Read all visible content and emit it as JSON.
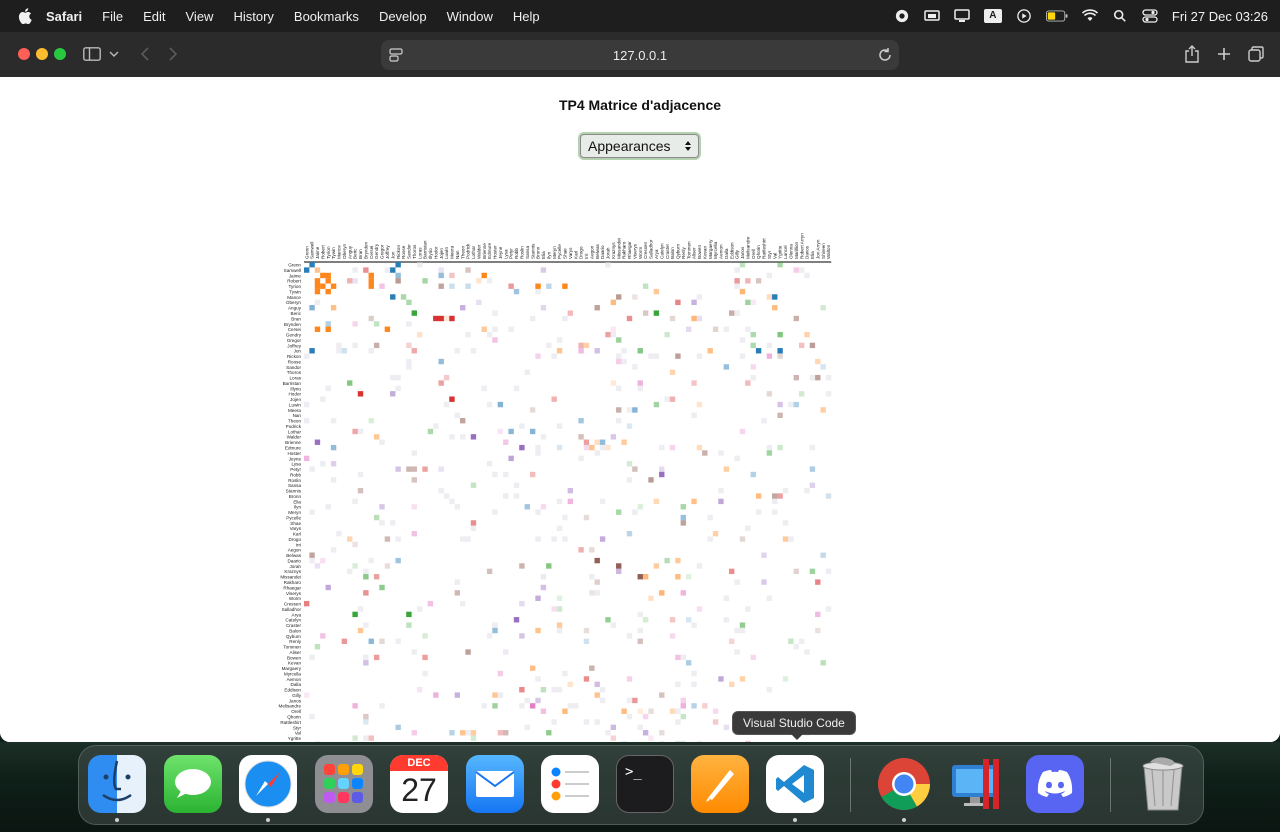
{
  "menubar": {
    "app_name": "Safari",
    "items": [
      "File",
      "Edit",
      "View",
      "History",
      "Bookmarks",
      "Develop",
      "Window",
      "Help"
    ],
    "clock": "Fri 27 Dec  03:26",
    "input_source": "A"
  },
  "browser": {
    "url": "127.0.0.1"
  },
  "page": {
    "title": "TP4 Matrice d'adjacence",
    "order_select": {
      "selected": "Appearances"
    }
  },
  "chart_data": {
    "type": "heatmap",
    "title": "TP4 Matrice d'adjacence",
    "ordering": "Appearances",
    "row_labels_visible": [
      "Grenn",
      "Samwell",
      "Jaime",
      "Robert",
      "Tyrion",
      "Tywin",
      "Mance",
      "Oberyn",
      "Anguy",
      "Beric",
      "Bran",
      "Brynden",
      "Cersei",
      "Gendry",
      "Gregor",
      "Joffrey",
      "Jon",
      "Rickon",
      "Roose",
      "Sandor",
      "Thoros",
      "Loras",
      "Barristan",
      "Illyrio",
      "Hodor",
      "Jojen",
      "Luwin",
      "Meera",
      "Nan",
      "Theon",
      "Podrick",
      "Lothar",
      "Walder",
      "Brienne",
      "Edmure",
      "Hoster",
      "Jeyne",
      "Lysa",
      "Petyr",
      "Robb",
      "Roslin",
      "Sansa",
      "Stannis",
      "Bronn",
      "Elia",
      "Ilyn",
      "Meryn",
      "Pycelle",
      "Shae",
      "Varys",
      "Karl",
      "Drogo",
      "Irri",
      "Aegon",
      "Belwas",
      "Daario",
      "Jorah",
      "Kraznys",
      "Missandei",
      "Rakharo",
      "Rhaegar",
      "Viserys",
      "Worm",
      "Cressen",
      "Salladhor",
      "Arya",
      "Catelyn",
      "Craster",
      "Balon",
      "Qyburn",
      "Renly",
      "Tommen",
      "Aliser",
      "Bowen",
      "Kevan",
      "Margaery",
      "Myrcella",
      "Aemon",
      "Dalla",
      "Eddison",
      "Gilly",
      "Janos",
      "Melisandre",
      "Orell",
      "Qhorin",
      "Rattleshirt",
      "Styr",
      "Val",
      "Ygritte",
      "Lancel",
      "Olenna",
      "Marillion",
      "Robert Arryn",
      "Davos"
    ],
    "col_labels_visible": [
      "Grenn",
      "Samwell",
      "Jaime",
      "Robert",
      "Tyrion",
      "Tywin",
      "Mance",
      "Oberyn",
      "Anguy",
      "Beric",
      "Bran",
      "Brynden",
      "Cersei",
      "Gendry",
      "Gregor",
      "Joffrey",
      "Jon",
      "Rickon",
      "Roose",
      "Sandor",
      "Thoros",
      "Loras",
      "Barristan",
      "Illyrio",
      "Hodor",
      "Jojen",
      "Luwin",
      "Meera",
      "Nan",
      "Theon",
      "Podrick",
      "Lothar",
      "Walder",
      "Brienne",
      "Edmure",
      "Hoster",
      "Jeyne",
      "Lysa",
      "Petyr",
      "Robb",
      "Roslin",
      "Sansa",
      "Stannis",
      "Bronn",
      "Elia",
      "Ilyn",
      "Meryn",
      "Pycelle",
      "Shae",
      "Varys",
      "Karl",
      "Drogo",
      "Irri",
      "Aegon",
      "Belwas",
      "Daario",
      "Jorah",
      "Kraznys",
      "Missandei",
      "Rakharo",
      "Rhaegar",
      "Viserys",
      "Worm",
      "Cressen",
      "Salladhor",
      "Arya",
      "Catelyn",
      "Craster",
      "Balon",
      "Qyburn",
      "Renly",
      "Tommen",
      "Aliser",
      "Bowen",
      "Kevan",
      "Margaery",
      "Myrcella",
      "Aemon",
      "Dalla",
      "Eddison",
      "Gilly",
      "Janos",
      "Melisandre",
      "Orell",
      "Qhorin",
      "Rattleshirt",
      "Styr",
      "Val",
      "Ygritte",
      "Lancel",
      "Olenna",
      "Marillion",
      "Robert Arryn",
      "Davos",
      "Elia",
      "Jon Arryn",
      "Shireen",
      "Walton"
    ],
    "group_colors": [
      "#1f77b4",
      "#ff7f0e",
      "#2ca02c",
      "#d62728",
      "#9467bd",
      "#8c564b",
      "#e377c2"
    ],
    "highlighted_cells": [
      {
        "row": "Grenn",
        "col": "Samwell",
        "group": 0
      },
      {
        "row": "Grenn",
        "col": "Rickon",
        "group": 0
      },
      {
        "row": "Samwell",
        "col": "Grenn",
        "group": 0
      },
      {
        "row": "Samwell",
        "col": "Jon",
        "group": 0
      },
      {
        "row": "Jaime",
        "col": "Robert",
        "group": 1
      },
      {
        "row": "Jaime",
        "col": "Tyrion",
        "group": 1
      },
      {
        "row": "Jaime",
        "col": "Cersei",
        "group": 1
      },
      {
        "row": "Jaime",
        "col": "Brienne",
        "group": 1
      },
      {
        "row": "Robert",
        "col": "Jaime",
        "group": 1
      },
      {
        "row": "Robert",
        "col": "Tyrion",
        "group": 1
      },
      {
        "row": "Robert",
        "col": "Cersei",
        "group": 1
      },
      {
        "row": "Tyrion",
        "col": "Jaime",
        "group": 1
      },
      {
        "row": "Tyrion",
        "col": "Robert",
        "group": 1
      },
      {
        "row": "Tyrion",
        "col": "Tywin",
        "group": 1
      },
      {
        "row": "Tyrion",
        "col": "Cersei",
        "group": 1
      },
      {
        "row": "Tyrion",
        "col": "Bronn",
        "group": 1
      },
      {
        "row": "Tyrion",
        "col": "Shae",
        "group": 1
      },
      {
        "row": "Tywin",
        "col": "Tyrion",
        "group": 1
      },
      {
        "row": "Tywin",
        "col": "Jaime",
        "group": 1
      },
      {
        "row": "Mance",
        "col": "Jon",
        "group": 0
      },
      {
        "row": "Mance",
        "col": "Val",
        "group": 0
      },
      {
        "row": "Beric",
        "col": "Arya",
        "group": 2
      },
      {
        "row": "Beric",
        "col": "Thoros",
        "group": 2
      },
      {
        "row": "Bran",
        "col": "Hodor",
        "group": 3
      },
      {
        "row": "Bran",
        "col": "Jojen",
        "group": 3
      },
      {
        "row": "Bran",
        "col": "Meera",
        "group": 3
      },
      {
        "row": "Cersei",
        "col": "Jaime",
        "group": 1
      },
      {
        "row": "Cersei",
        "col": "Tyrion",
        "group": 1
      },
      {
        "row": "Cersei",
        "col": "Joffrey",
        "group": 1
      },
      {
        "row": "Jon",
        "col": "Samwell",
        "group": 0
      },
      {
        "row": "Jon",
        "col": "Ygritte",
        "group": 0
      },
      {
        "row": "Jon",
        "col": "Qhorin",
        "group": 0
      },
      {
        "row": "Hodor",
        "col": "Bran",
        "group": 3
      },
      {
        "row": "Jojen",
        "col": "Meera",
        "group": 3
      },
      {
        "row": "Walder",
        "col": "Lothar",
        "group": 4
      },
      {
        "row": "Brienne",
        "col": "Jaime",
        "group": 4
      },
      {
        "row": "Edmure",
        "col": "Roslin",
        "group": 4
      },
      {
        "row": "Robb",
        "col": "Catelyn",
        "group": 4
      },
      {
        "row": "Daario",
        "col": "Belwas",
        "group": 5
      },
      {
        "row": "Jorah",
        "col": "Missandei",
        "group": 5
      },
      {
        "row": "Missandei",
        "col": "Worm",
        "group": 5
      },
      {
        "row": "Arya",
        "col": "Sandor",
        "group": 2
      },
      {
        "row": "Arya",
        "col": "Beric",
        "group": 2
      },
      {
        "row": "Catelyn",
        "col": "Robb",
        "group": 4
      },
      {
        "row": "Davos",
        "col": "Stannis",
        "group": 6
      },
      {
        "row": "Melisandre",
        "col": "Stannis",
        "group": 6
      }
    ]
  },
  "tooltip": {
    "text": "Visual Studio Code"
  },
  "dock": {
    "calendar_month": "DEC",
    "calendar_day": "27",
    "apps": [
      "Finder",
      "Messages",
      "Safari",
      "Launchpad",
      "Calendar",
      "Mail",
      "Reminders",
      "Terminal",
      "Pages",
      "Visual Studio Code",
      "Google Chrome",
      "Parallels",
      "Discord",
      "Trash"
    ]
  }
}
